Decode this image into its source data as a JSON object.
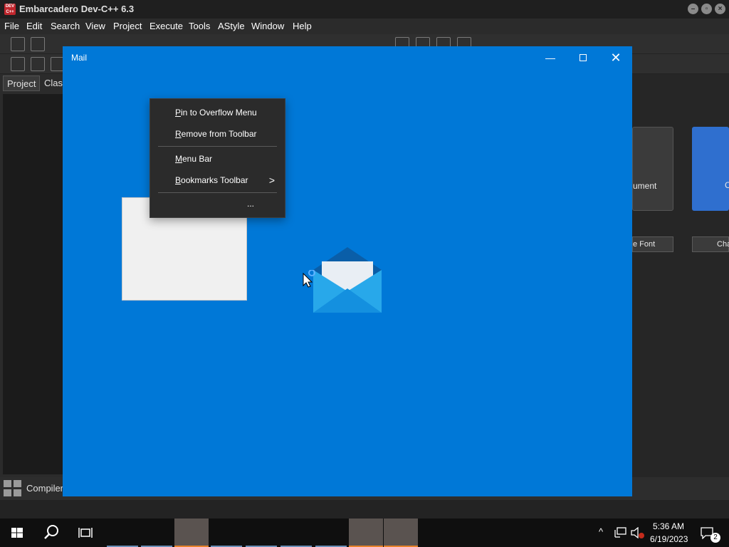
{
  "ide": {
    "title": "Embarcadero Dev-C++ 6.3",
    "icon_text": "DEV C++",
    "menu": [
      "File",
      "Edit",
      "Search",
      "View",
      "Project",
      "Execute",
      "Tools",
      "AStyle",
      "Window",
      "Help"
    ],
    "left_tabs": [
      "Project",
      "Clas"
    ],
    "bottom_label": "Compiler",
    "right_card_label": "ument",
    "right_button_1": "e Font",
    "right_button_2": "Cha",
    "right_card_2_label": "C"
  },
  "mail": {
    "title": "Mail",
    "minimize_glyph": "—",
    "close_glyph": "✕"
  },
  "context_menu": {
    "items": [
      {
        "label": "Pin to Overflow Menu",
        "accel": "P"
      },
      {
        "label": "Remove from Toolbar",
        "accel": "R"
      },
      {
        "label": "Menu Bar",
        "accel": "M"
      },
      {
        "label": "Bookmarks Toolbar",
        "accel": "B"
      }
    ],
    "hidden_item_tail": "...",
    "submenu_arrow": ">"
  },
  "taskbar": {
    "time": "5:36 AM",
    "date": "6/19/2023",
    "notification_count": "2"
  },
  "colors": {
    "mail_bg": "#0078d7",
    "menu_bg": "#2b2b2b",
    "taskbar_bg": "#0f0f0f",
    "active_app_accent": "#e8822a"
  }
}
